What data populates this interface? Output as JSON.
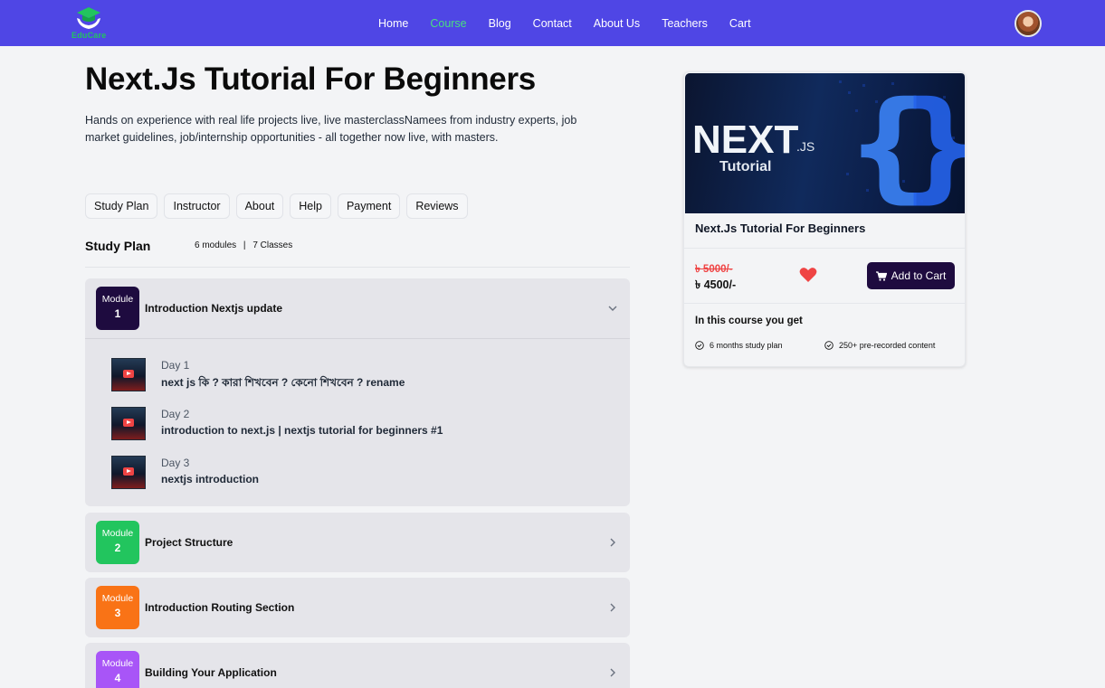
{
  "brand": {
    "name": "EduCare",
    "logo_icon": "graduation-cap-hands-icon",
    "colors": {
      "nav": "#4f46e5",
      "accent_green": "#4ade80"
    }
  },
  "nav": {
    "links": [
      {
        "label": "Home",
        "active": false
      },
      {
        "label": "Course",
        "active": true
      },
      {
        "label": "Blog",
        "active": false
      },
      {
        "label": "Contact",
        "active": false
      },
      {
        "label": "About Us",
        "active": false
      },
      {
        "label": "Teachers",
        "active": false
      },
      {
        "label": "Cart",
        "active": false
      }
    ]
  },
  "course": {
    "title": "Next.Js Tutorial For Beginners",
    "description": "Hands on experience with real life projects live, live masterclassNamees from industry experts, job market guidelines, job/internship opportunities - all together now live, with masters."
  },
  "tabs": [
    "Study Plan",
    "Instructor",
    "About",
    "Help",
    "Payment",
    "Reviews"
  ],
  "study_plan": {
    "title": "Study Plan",
    "modules_count": "6 modules",
    "separator": "|",
    "classes_count": "7 Classes",
    "modules": [
      {
        "label": "Module",
        "number": "1",
        "title": "Introduction Nextjs update",
        "color": "#1e0b3f",
        "expanded": true,
        "lessons": [
          {
            "day": "Day 1",
            "name": "next js কি ? কারা শিখবেন ? কেনো শিখবেন ? rename"
          },
          {
            "day": "Day 2",
            "name": "introduction to next.js | nextjs tutorial for beginners #1"
          },
          {
            "day": "Day 3",
            "name": "nextjs introduction"
          }
        ]
      },
      {
        "label": "Module",
        "number": "2",
        "title": "Project Structure",
        "color": "#22c55e",
        "expanded": false
      },
      {
        "label": "Module",
        "number": "3",
        "title": "Introduction Routing Section",
        "color": "#f97316",
        "expanded": false
      },
      {
        "label": "Module",
        "number": "4",
        "title": "Building Your Application",
        "color": "#a855f7",
        "expanded": false
      }
    ]
  },
  "card": {
    "image": {
      "big_text": "NEXT",
      "small_text": ".JS",
      "subtitle": "Tutorial"
    },
    "name": "Next.Js Tutorial For Beginners",
    "old_price": "৳ 5000/-",
    "new_price": "৳ 4500/-",
    "cart_button": "Add to Cart",
    "you_get_title": "In this course you get",
    "features": [
      "6 months study plan",
      "250+ pre-recorded content"
    ]
  }
}
